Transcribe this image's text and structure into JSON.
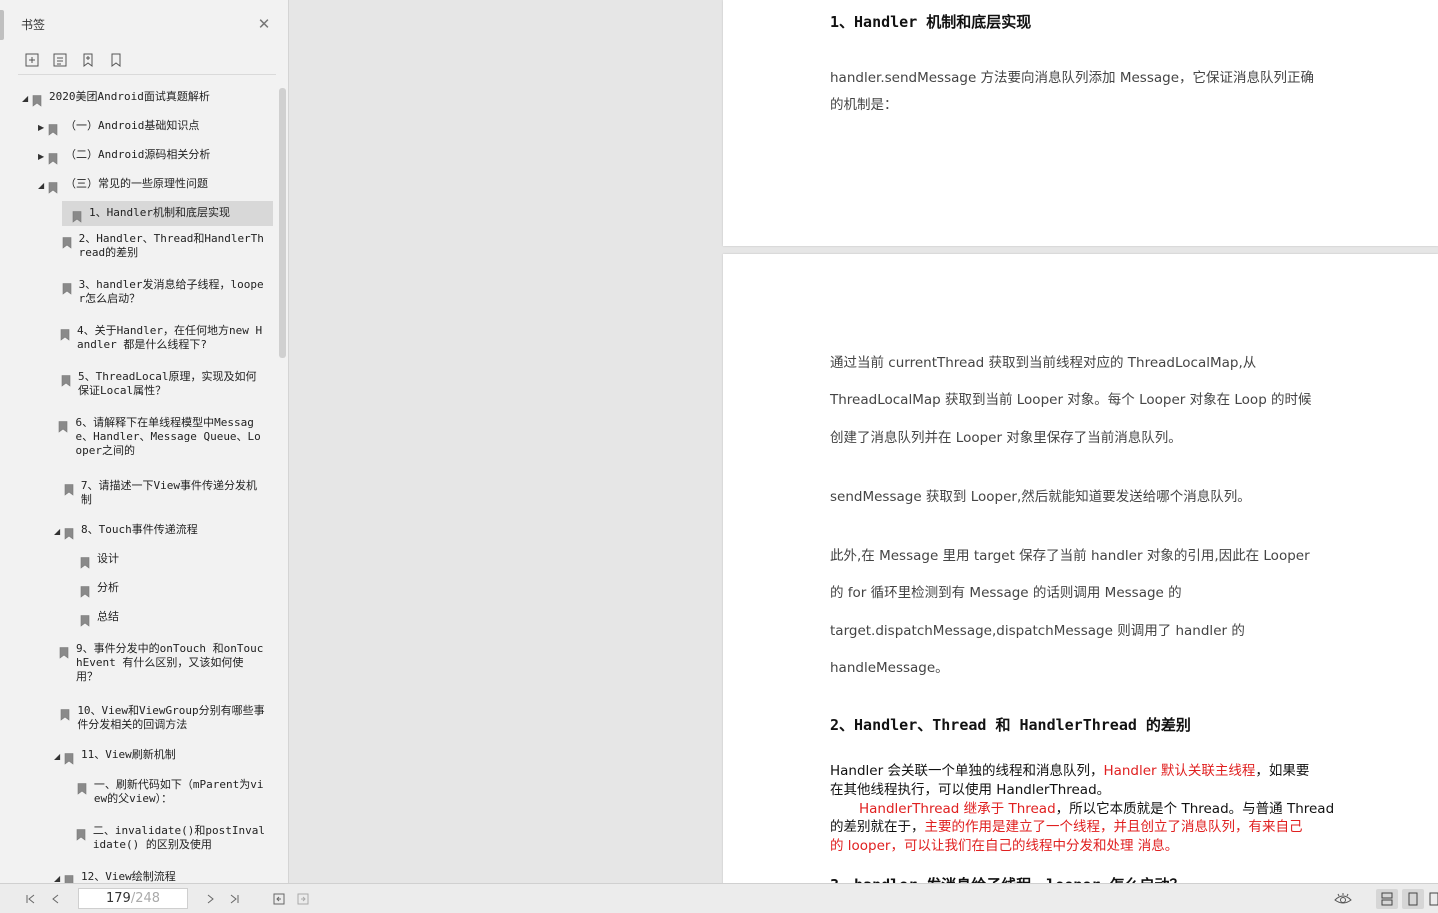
{
  "sidebar": {
    "title": "书签",
    "close_icon": "close-icon",
    "tools": [
      "expand-all-icon",
      "collapse-all-icon",
      "add-bookmark-icon",
      "bookmark-icon"
    ],
    "items": [
      {
        "label": "2020美团Android面试真题解析",
        "level": 0,
        "expanded": true,
        "has_children": true
      },
      {
        "label": "（一）Android基础知识点",
        "level": 1,
        "expanded": false,
        "has_children": true
      },
      {
        "label": "（二）Android源码相关分析",
        "level": 1,
        "expanded": false,
        "has_children": true
      },
      {
        "label": "（三）常见的一些原理性问题",
        "level": 1,
        "expanded": true,
        "has_children": true
      },
      {
        "label": "1、Handler机制和底层实现",
        "level": 2,
        "selected": true
      },
      {
        "label": "2、Handler、Thread和HandlerThread的差别",
        "level": 2
      },
      {
        "label": "3、handler发消息给子线程，looper怎么启动？",
        "level": 2
      },
      {
        "label": "4、关于Handler，在任何地方new Handler 都是什么线程下?",
        "level": 2
      },
      {
        "label": "5、ThreadLocal原理，实现及如何保证Local属性？",
        "level": 2
      },
      {
        "label": "6、请解释下在单线程模型中Message、Handler、Message Queue、Looper之间的",
        "level": 2
      },
      {
        "label": "7、请描述一下View事件传递分发机制",
        "level": 2
      },
      {
        "label": "8、Touch事件传递流程",
        "level": 2,
        "expanded": true,
        "has_children": true
      },
      {
        "label": "设计",
        "level": 3
      },
      {
        "label": "分析",
        "level": 3
      },
      {
        "label": "总结",
        "level": 3
      },
      {
        "label": "9、事件分发中的onTouch 和onTouchEvent 有什么区别，又该如何使用？",
        "level": 2
      },
      {
        "label": "10、View和ViewGroup分别有哪些事件分发相关的回调方法",
        "level": 2
      },
      {
        "label": "11、View刷新机制",
        "level": 2,
        "expanded": true,
        "has_children": true
      },
      {
        "label": "一、刷新代码如下（mParent为view的父view）：",
        "level": 3
      },
      {
        "label": "二、invalidate()和postInvalidate() 的区别及使用",
        "level": 3
      },
      {
        "label": "12、View绘制流程",
        "level": 2,
        "expanded": true,
        "has_children": true
      }
    ]
  },
  "doc": {
    "page1": {
      "heading": "1、Handler 机制和底层实现",
      "para_line1": "handler.sendMessage 方法要向消息队列添加 Message，它保证消息队列正确",
      "para_line2": "的机制是："
    },
    "page2": {
      "lines": [
        "通过当前 currentThread 获取到当前线程对应的 ThreadLocalMap,从",
        "ThreadLocalMap 获取到当前 Looper 对象。每个 Looper 对象在 Loop 的时候",
        "创建了消息队列并在 Looper 对象里保存了当前消息队列。",
        "sendMessage 获取到 Looper,然后就能知道要发送给哪个消息队列。",
        "此外,在 Message 里用  target 保存了当前 handler 对象的引用,因此在 Looper",
        "的 for 循环里检测到有 Message 的话则调用 Message 的",
        "target.dispatchMessage,dispatchMessage 则调用了 handler 的",
        "handleMessage。"
      ],
      "heading2": "2、Handler、Thread 和 HandlerThread 的差别",
      "p_a1": "Handler 会关联一个单独的线程和消息队列，",
      "p_a1_red": "Handler 默认关联主线程",
      "p_a1_end": "，如果要",
      "p_a2": "在其他线程执行，可以使用 HandlerThread。",
      "p_b1_red": "HandlerThread 继承于 Thread",
      "p_b1": "，所以它本质就是个 Thread。与普通 Thread",
      "p_b2": "的差别就在于，",
      "p_b2_red": "主要的作用是建立了一个线程，并且创立了消息队列，有来自己",
      "p_b3_red": "的 looper，可以让我们在自己的线程中分发和处理     消息。",
      "partial_heading": "3、handler 发消息给子线程，looper 怎么启动？"
    }
  },
  "status": {
    "current_page": "179",
    "total_pages": "/248"
  }
}
